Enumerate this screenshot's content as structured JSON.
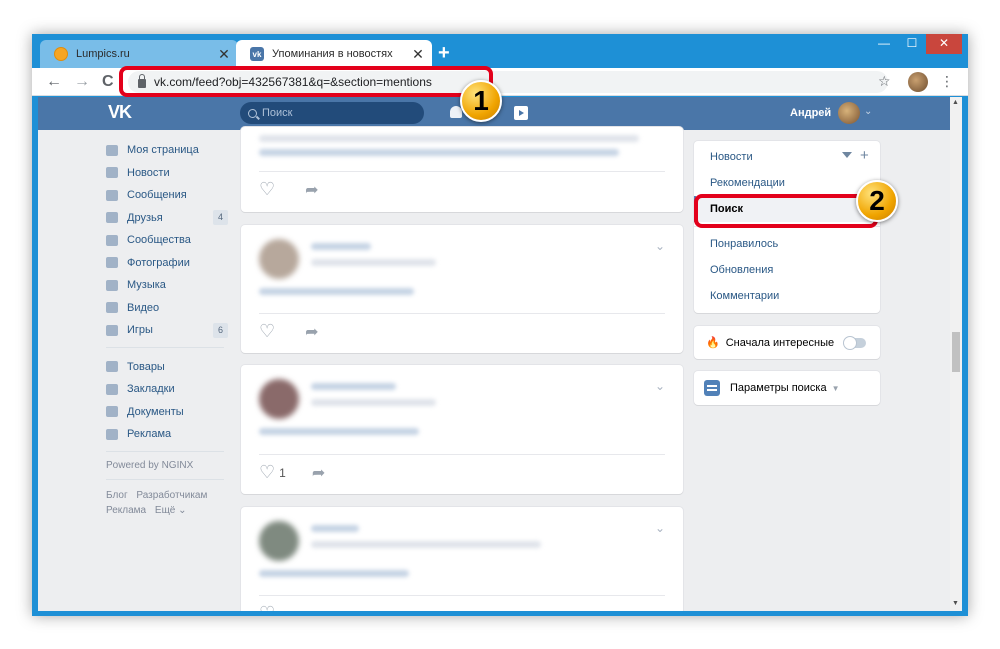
{
  "browser": {
    "tabs": [
      {
        "title": "Lumpics.ru",
        "active": false
      },
      {
        "title": "Упоминания в новостях",
        "active": true
      }
    ],
    "new_tab": "+",
    "window_controls": {
      "minimize": "—",
      "maximize": "☐",
      "close": "✕"
    },
    "nav": {
      "back": "←",
      "forward": "→",
      "reload": "C"
    },
    "url": "vk.com/feed?obj=432567381&q=&section=mentions",
    "bookmark_star": "☆",
    "menu": "⋮"
  },
  "vk_header": {
    "logo": "VK",
    "search_placeholder": "Поиск",
    "user_name": "Андрей",
    "chevron": "⌄"
  },
  "left_menu": {
    "items": [
      {
        "label": "Моя страница",
        "icon": "home-icon",
        "count": ""
      },
      {
        "label": "Новости",
        "icon": "news-icon",
        "count": ""
      },
      {
        "label": "Сообщения",
        "icon": "messages-icon",
        "count": ""
      },
      {
        "label": "Друзья",
        "icon": "friends-icon",
        "count": "4"
      },
      {
        "label": "Сообщества",
        "icon": "communities-icon",
        "count": ""
      },
      {
        "label": "Фотографии",
        "icon": "photos-icon",
        "count": ""
      },
      {
        "label": "Музыка",
        "icon": "music-icon",
        "count": ""
      },
      {
        "label": "Видео",
        "icon": "video-icon",
        "count": ""
      },
      {
        "label": "Игры",
        "icon": "games-icon",
        "count": "6"
      }
    ],
    "items2": [
      {
        "label": "Товары",
        "icon": "goods-icon"
      },
      {
        "label": "Закладки",
        "icon": "bookmarks-icon"
      },
      {
        "label": "Документы",
        "icon": "documents-icon"
      },
      {
        "label": "Реклама",
        "icon": "ads-icon"
      }
    ],
    "powered": "Powered by NGINX",
    "footer_links": [
      "Блог",
      "Разработчикам",
      "Реклама",
      "Ещё ⌄"
    ]
  },
  "feed": {
    "posts": [
      {
        "likes": ""
      },
      {
        "likes": ""
      },
      {
        "likes": "1"
      },
      {
        "likes": ""
      }
    ]
  },
  "right_menu": {
    "items": [
      "Новости",
      "Рекомендации",
      "Поиск",
      "Понравилось",
      "Обновления",
      "Комментарии"
    ],
    "active": "Поиск",
    "interesting_first": "Сначала интересные",
    "search_params": "Параметры поиска"
  },
  "callouts": {
    "one": "1",
    "two": "2"
  },
  "colors": {
    "vk_blue": "#4a76a8",
    "browser_blue": "#1e90d6",
    "callout_red": "#e3001b",
    "badge_gold": "#f0a400"
  }
}
